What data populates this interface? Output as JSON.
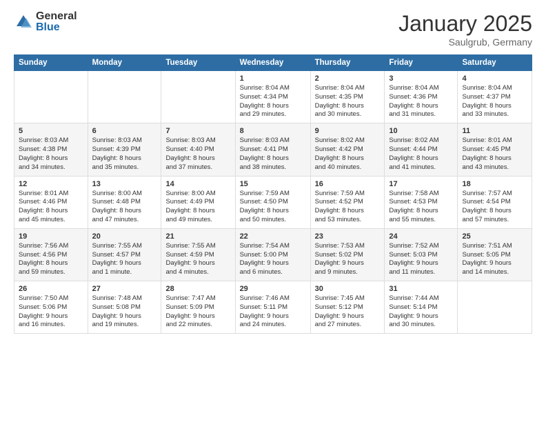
{
  "logo": {
    "general": "General",
    "blue": "Blue"
  },
  "title": "January 2025",
  "location": "Saulgrub, Germany",
  "days_header": [
    "Sunday",
    "Monday",
    "Tuesday",
    "Wednesday",
    "Thursday",
    "Friday",
    "Saturday"
  ],
  "weeks": [
    [
      {
        "day": "",
        "info": ""
      },
      {
        "day": "",
        "info": ""
      },
      {
        "day": "",
        "info": ""
      },
      {
        "day": "1",
        "info": "Sunrise: 8:04 AM\nSunset: 4:34 PM\nDaylight: 8 hours\nand 29 minutes."
      },
      {
        "day": "2",
        "info": "Sunrise: 8:04 AM\nSunset: 4:35 PM\nDaylight: 8 hours\nand 30 minutes."
      },
      {
        "day": "3",
        "info": "Sunrise: 8:04 AM\nSunset: 4:36 PM\nDaylight: 8 hours\nand 31 minutes."
      },
      {
        "day": "4",
        "info": "Sunrise: 8:04 AM\nSunset: 4:37 PM\nDaylight: 8 hours\nand 33 minutes."
      }
    ],
    [
      {
        "day": "5",
        "info": "Sunrise: 8:03 AM\nSunset: 4:38 PM\nDaylight: 8 hours\nand 34 minutes."
      },
      {
        "day": "6",
        "info": "Sunrise: 8:03 AM\nSunset: 4:39 PM\nDaylight: 8 hours\nand 35 minutes."
      },
      {
        "day": "7",
        "info": "Sunrise: 8:03 AM\nSunset: 4:40 PM\nDaylight: 8 hours\nand 37 minutes."
      },
      {
        "day": "8",
        "info": "Sunrise: 8:03 AM\nSunset: 4:41 PM\nDaylight: 8 hours\nand 38 minutes."
      },
      {
        "day": "9",
        "info": "Sunrise: 8:02 AM\nSunset: 4:42 PM\nDaylight: 8 hours\nand 40 minutes."
      },
      {
        "day": "10",
        "info": "Sunrise: 8:02 AM\nSunset: 4:44 PM\nDaylight: 8 hours\nand 41 minutes."
      },
      {
        "day": "11",
        "info": "Sunrise: 8:01 AM\nSunset: 4:45 PM\nDaylight: 8 hours\nand 43 minutes."
      }
    ],
    [
      {
        "day": "12",
        "info": "Sunrise: 8:01 AM\nSunset: 4:46 PM\nDaylight: 8 hours\nand 45 minutes."
      },
      {
        "day": "13",
        "info": "Sunrise: 8:00 AM\nSunset: 4:48 PM\nDaylight: 8 hours\nand 47 minutes."
      },
      {
        "day": "14",
        "info": "Sunrise: 8:00 AM\nSunset: 4:49 PM\nDaylight: 8 hours\nand 49 minutes."
      },
      {
        "day": "15",
        "info": "Sunrise: 7:59 AM\nSunset: 4:50 PM\nDaylight: 8 hours\nand 50 minutes."
      },
      {
        "day": "16",
        "info": "Sunrise: 7:59 AM\nSunset: 4:52 PM\nDaylight: 8 hours\nand 53 minutes."
      },
      {
        "day": "17",
        "info": "Sunrise: 7:58 AM\nSunset: 4:53 PM\nDaylight: 8 hours\nand 55 minutes."
      },
      {
        "day": "18",
        "info": "Sunrise: 7:57 AM\nSunset: 4:54 PM\nDaylight: 8 hours\nand 57 minutes."
      }
    ],
    [
      {
        "day": "19",
        "info": "Sunrise: 7:56 AM\nSunset: 4:56 PM\nDaylight: 8 hours\nand 59 minutes."
      },
      {
        "day": "20",
        "info": "Sunrise: 7:55 AM\nSunset: 4:57 PM\nDaylight: 9 hours\nand 1 minute."
      },
      {
        "day": "21",
        "info": "Sunrise: 7:55 AM\nSunset: 4:59 PM\nDaylight: 9 hours\nand 4 minutes."
      },
      {
        "day": "22",
        "info": "Sunrise: 7:54 AM\nSunset: 5:00 PM\nDaylight: 9 hours\nand 6 minutes."
      },
      {
        "day": "23",
        "info": "Sunrise: 7:53 AM\nSunset: 5:02 PM\nDaylight: 9 hours\nand 9 minutes."
      },
      {
        "day": "24",
        "info": "Sunrise: 7:52 AM\nSunset: 5:03 PM\nDaylight: 9 hours\nand 11 minutes."
      },
      {
        "day": "25",
        "info": "Sunrise: 7:51 AM\nSunset: 5:05 PM\nDaylight: 9 hours\nand 14 minutes."
      }
    ],
    [
      {
        "day": "26",
        "info": "Sunrise: 7:50 AM\nSunset: 5:06 PM\nDaylight: 9 hours\nand 16 minutes."
      },
      {
        "day": "27",
        "info": "Sunrise: 7:48 AM\nSunset: 5:08 PM\nDaylight: 9 hours\nand 19 minutes."
      },
      {
        "day": "28",
        "info": "Sunrise: 7:47 AM\nSunset: 5:09 PM\nDaylight: 9 hours\nand 22 minutes."
      },
      {
        "day": "29",
        "info": "Sunrise: 7:46 AM\nSunset: 5:11 PM\nDaylight: 9 hours\nand 24 minutes."
      },
      {
        "day": "30",
        "info": "Sunrise: 7:45 AM\nSunset: 5:12 PM\nDaylight: 9 hours\nand 27 minutes."
      },
      {
        "day": "31",
        "info": "Sunrise: 7:44 AM\nSunset: 5:14 PM\nDaylight: 9 hours\nand 30 minutes."
      },
      {
        "day": "",
        "info": ""
      }
    ]
  ]
}
